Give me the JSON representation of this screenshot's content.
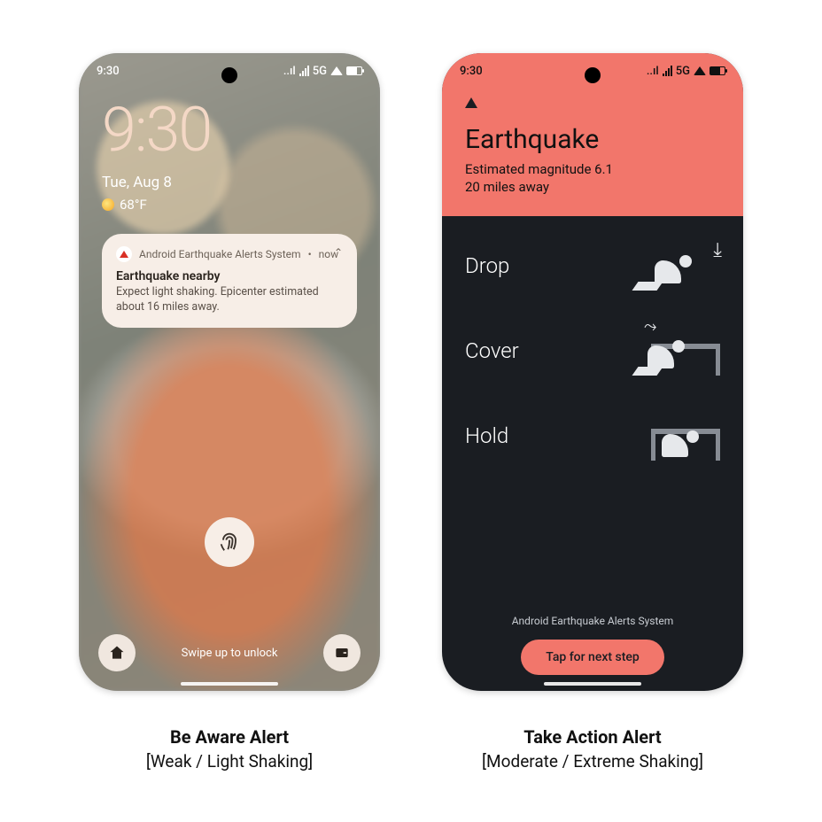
{
  "statusbar": {
    "time": "9:30",
    "network": "5G"
  },
  "lockscreen": {
    "clock": "9:30",
    "date": "Tue, Aug 8",
    "temp": "68°F",
    "notification": {
      "app": "Android Earthquake Alerts System",
      "when": "now",
      "title": "Earthquake nearby",
      "body": "Expect light shaking. Epicenter estimated about 16 miles away."
    },
    "unlock_hint": "Swipe up to unlock"
  },
  "take_action": {
    "title": "Earthquake",
    "magnitude_line": "Estimated magnitude 6.1",
    "distance_line": "20 miles away",
    "steps": [
      {
        "label": "Drop"
      },
      {
        "label": "Cover"
      },
      {
        "label": "Hold"
      }
    ],
    "system_line": "Android Earthquake Alerts System",
    "button": "Tap for next step"
  },
  "captions": {
    "left_title": "Be Aware Alert",
    "left_sub": "[Weak / Light Shaking]",
    "right_title": "Take Action Alert",
    "right_sub": "[Moderate / Extreme Shaking]"
  }
}
